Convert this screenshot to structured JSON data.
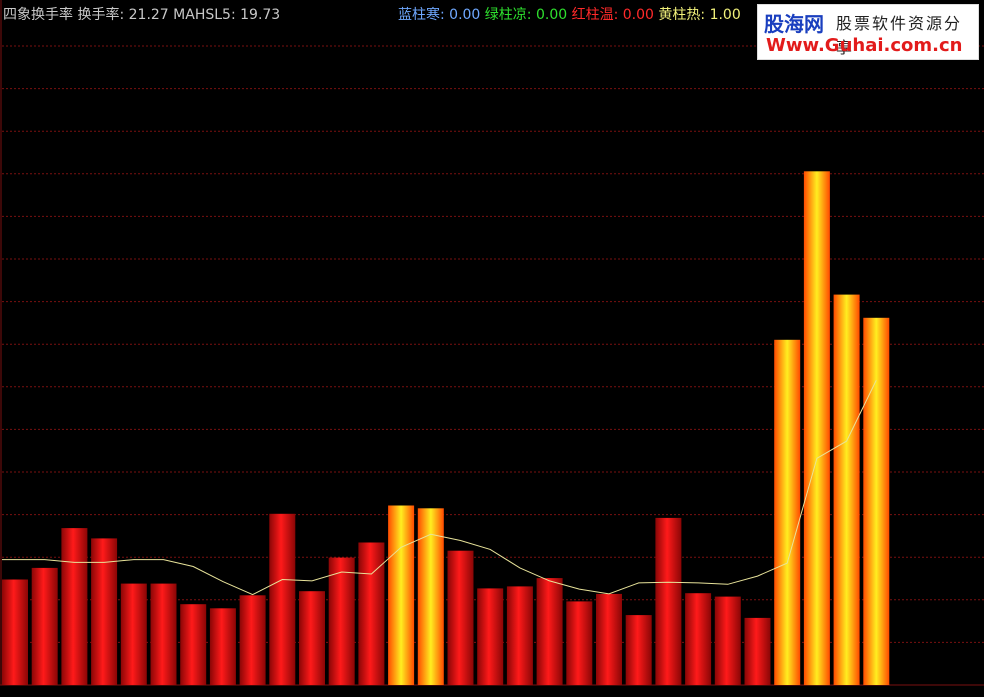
{
  "header": {
    "indicator_name": "四象换手率",
    "series_label": "换手率:",
    "series_value": "21.27",
    "ma_label": "MAHSL5:",
    "ma_value": "19.73",
    "blue_label": "蓝柱寒:",
    "blue_value": "0.00",
    "green_label": "绿柱凉:",
    "green_value": "0.00",
    "red_label": "红柱温:",
    "red_value": "0.00",
    "yellow_label": "黄柱热:",
    "yellow_value": "1.00"
  },
  "watermark": {
    "logo": "股海网",
    "slogan": "股票软件资源分享",
    "url": "Www.Guhai.com.cn"
  },
  "colors": {
    "background": "#000000",
    "grid": "#7a1010",
    "red_bar": "#d41414",
    "hot_bar_edge": "#ff5a00",
    "hot_bar_center": "#ffe000",
    "ma_line": "#e8e39a",
    "blue_label": "#6fa8ff",
    "green_label": "#2ee02e",
    "red_label": "#ff2a2a",
    "yellow_label": "#f0f07a"
  },
  "chart_data": {
    "type": "bar",
    "title": "四象换手率",
    "ylim": [
      0,
      100
    ],
    "grid": true,
    "series": [
      {
        "name": "换手率",
        "values": [
          15.4,
          17.1,
          22.9,
          21.4,
          14.8,
          14.8,
          11.8,
          11.2,
          13.1,
          25.0,
          13.7,
          18.6,
          20.8,
          26.2,
          25.8,
          19.6,
          14.1,
          14.4,
          15.6,
          12.2,
          13.3,
          10.2,
          24.4,
          13.4,
          12.9,
          9.8,
          50.4,
          75.0,
          57.0,
          53.6
        ]
      },
      {
        "name": "MAHSL5",
        "values": [
          18.3,
          18.3,
          17.9,
          17.9,
          18.3,
          18.3,
          17.3,
          15.1,
          13.2,
          15.4,
          15.2,
          16.5,
          16.2,
          20.1,
          22.0,
          21.1,
          19.8,
          17.1,
          15.2,
          14.0,
          13.3,
          14.9,
          15.0,
          14.9,
          14.7,
          15.9,
          17.8,
          33.1,
          35.6,
          44.5
        ]
      }
    ],
    "hot_bars": [
      false,
      false,
      false,
      false,
      false,
      false,
      false,
      false,
      false,
      false,
      false,
      false,
      false,
      true,
      true,
      false,
      false,
      false,
      false,
      false,
      false,
      false,
      false,
      false,
      false,
      false,
      true,
      true,
      true,
      true
    ]
  }
}
